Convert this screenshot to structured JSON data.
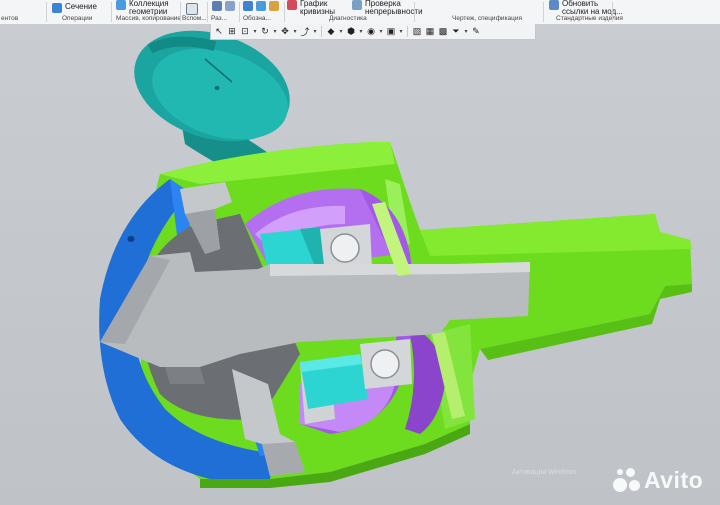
{
  "ribbon": {
    "left_group_label": "ентов",
    "operations": {
      "label": "Сечение",
      "group": "Операции"
    },
    "mass": {
      "label_line1": "Коллекция",
      "label_line2": "геометрии",
      "group": "Массив, копирование"
    },
    "aux": {
      "group": "Вспом..."
    },
    "sizes": {
      "group": "Раз..."
    },
    "notation": {
      "group": "Обозна..."
    },
    "diagnostics": {
      "curvature_line1": "График",
      "curvature_line2": "кривизны",
      "continuity_line1": "Проверка",
      "continuity_line2": "непрерывности",
      "group": "Диагностика"
    },
    "drawing": {
      "group": "Чертеж, спецификация"
    },
    "standard": {
      "label_line1": "Обновить",
      "label_line2": "ссылки на мод...",
      "group": "Стандартные изделия"
    }
  },
  "quick_toolbar": {
    "icons": [
      "select-icon",
      "zoom-window-icon",
      "zoom-dropdown-icon",
      "rotate-icon",
      "pan-icon",
      "orient-icon",
      "shading-icon",
      "display-mode-icon",
      "hide-icon",
      "section-icon",
      "filter-icon",
      "layers-icon",
      "color-icon",
      "funnel-icon",
      "pen-icon"
    ]
  },
  "watermark": {
    "brand": "Avito",
    "ghost_text": "Активация Windows"
  },
  "colors": {
    "housing_green": "#6ddb1e",
    "flange_blue": "#1f6fd6",
    "rotor_purple": "#b46ef0",
    "bearing_cyan": "#2cd5d1",
    "shaft_grey": "#b9bcbf",
    "knob_teal": "#1ba5a0"
  }
}
